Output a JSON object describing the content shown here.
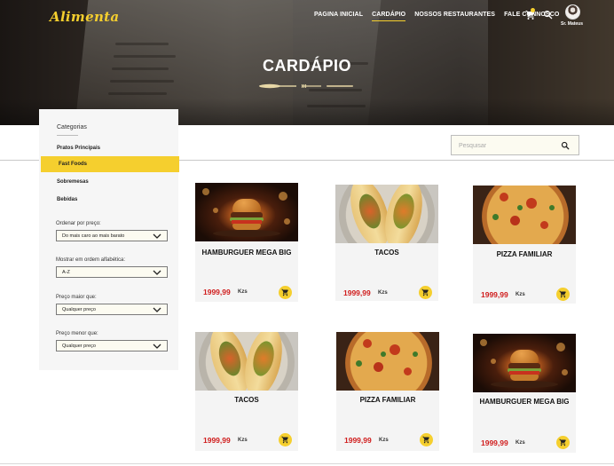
{
  "brand": {
    "logo": "Alimenta"
  },
  "nav": {
    "items": [
      {
        "label": "PAGINA INICIAL",
        "active": false
      },
      {
        "label": "CARDÁPIO",
        "active": true
      },
      {
        "label": "NOSSOS RESTAURANTES",
        "active": false
      },
      {
        "label": "FALE CONNOSCO",
        "active": false
      }
    ],
    "icons": [
      "cart-icon",
      "search-icon"
    ],
    "user_name": "Sr. Mateus"
  },
  "hero": {
    "title": "CARDÁPIO"
  },
  "sidebar": {
    "heading": "Categorias",
    "categories": [
      {
        "label": "Pratos Principais",
        "active": false
      },
      {
        "label": "Fast Foods",
        "active": true
      },
      {
        "label": "Sobremesas",
        "active": false
      },
      {
        "label": "Bebidas",
        "active": false
      }
    ],
    "filters": [
      {
        "label": "Ordenar por preço:",
        "value": "Do mais caro ao mais barato"
      },
      {
        "label": "Mostrar em ordem alfabética:",
        "value": "A-Z"
      },
      {
        "label": "Preço maior que:",
        "value": "Qualquer preço"
      },
      {
        "label": "Preço menor que:",
        "value": "Qualquer preço"
      }
    ]
  },
  "search": {
    "placeholder": "Pesquisar",
    "value": ""
  },
  "products": [
    {
      "name": "HAMBURGUER MEGA BIG",
      "price": "1999,99",
      "currency": "Kzs",
      "image": "burger"
    },
    {
      "name": "TACOS",
      "price": "1999,99",
      "currency": "Kzs",
      "image": "tacos"
    },
    {
      "name": "PIZZA FAMILIAR",
      "price": "1999,99",
      "currency": "Kzs",
      "image": "pizza"
    },
    {
      "name": "TACOS",
      "price": "1999,99",
      "currency": "Kzs",
      "image": "tacos"
    },
    {
      "name": "PIZZA FAMILIAR",
      "price": "1999,99",
      "currency": "Kzs",
      "image": "pizza"
    },
    {
      "name": "HAMBURGUER MEGA BIG",
      "price": "1999,99",
      "currency": "Kzs",
      "image": "burger"
    }
  ],
  "colors": {
    "accent": "#f5cf2e",
    "price": "#d01d1d",
    "panel": "#f6f6f6"
  }
}
